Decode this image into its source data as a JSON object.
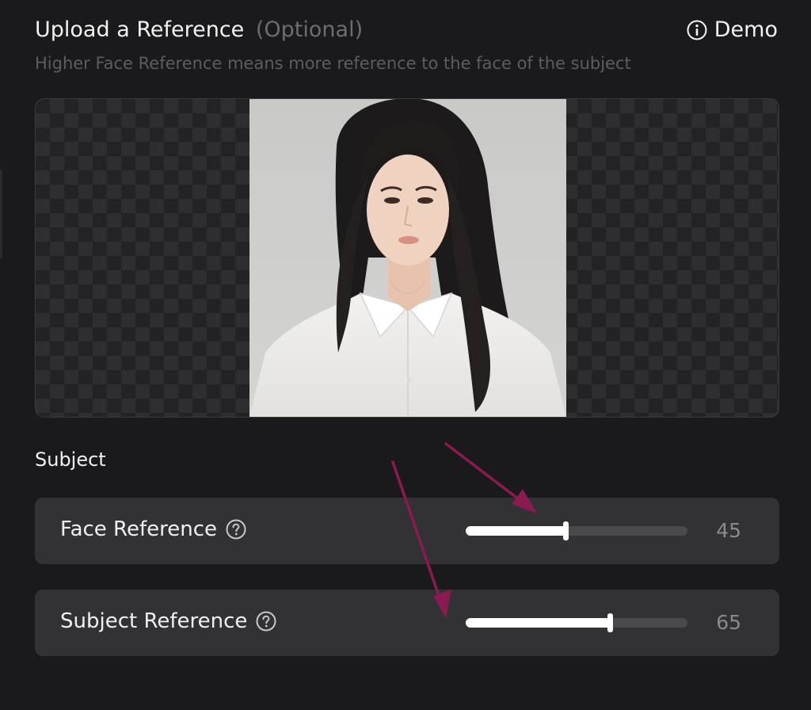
{
  "header": {
    "title": "Upload a Reference",
    "optional": "(Optional)",
    "demo_label": "Demo",
    "demo_icon": "info-circle-icon",
    "subtitle": "Higher Face Reference means more reference to the face of the subject"
  },
  "upload": {
    "image_description": "portrait reference photo"
  },
  "subject_section": {
    "label": "Subject",
    "sliders": [
      {
        "label": "Face Reference",
        "value": "45",
        "level": 0.45,
        "icon": "question-circle-icon"
      },
      {
        "label": "Subject Reference",
        "value": "65",
        "level": 0.65,
        "icon": "question-circle-icon"
      }
    ]
  },
  "colors": {
    "background": "#1a1a1d",
    "card": "#323235",
    "track": "#4a4a4e",
    "fill": "#ffffff",
    "annotation_arrow": "#8b1a52"
  }
}
